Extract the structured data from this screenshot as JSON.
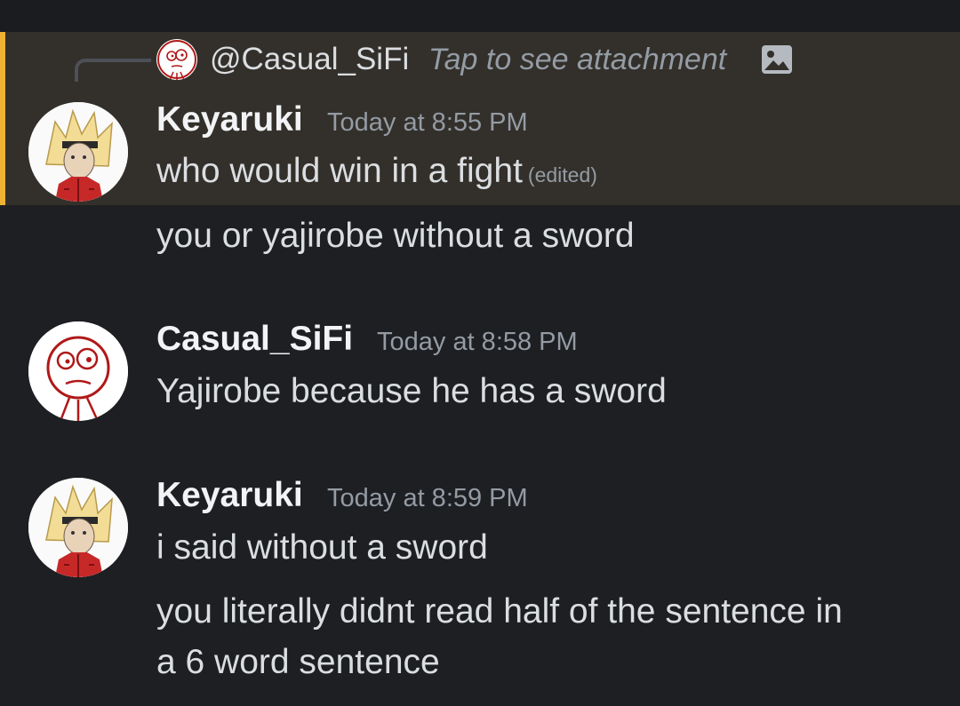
{
  "colors": {
    "background": "#1e1f22",
    "mention_highlight": "#33302b",
    "mention_bar": "#f0b232",
    "username": "#f2f3f5",
    "muted": "#949ba4",
    "message_text": "#dbdee1"
  },
  "reply": {
    "mention": "@Casual_SiFi",
    "text": "Tap to see attachment",
    "avatar_icon": "casual-sifi-avatar",
    "attachment_icon": "image-icon"
  },
  "messages": [
    {
      "author": "Keyaruki",
      "timestamp": "Today at 8:55 PM",
      "lines": [
        "who would win in a fight",
        "you or yajirobe without a sword"
      ],
      "edited_label": "(edited)",
      "mentions_you": true
    },
    {
      "author": "Casual_SiFi",
      "timestamp": "Today at 8:58 PM",
      "lines": [
        "Yajirobe because he has a sword"
      ]
    },
    {
      "author": "Keyaruki",
      "timestamp": "Today at 8:59 PM",
      "lines": [
        "i said without a sword",
        "you literally didnt read half of the sentence in",
        "a 6 word sentence"
      ]
    }
  ]
}
